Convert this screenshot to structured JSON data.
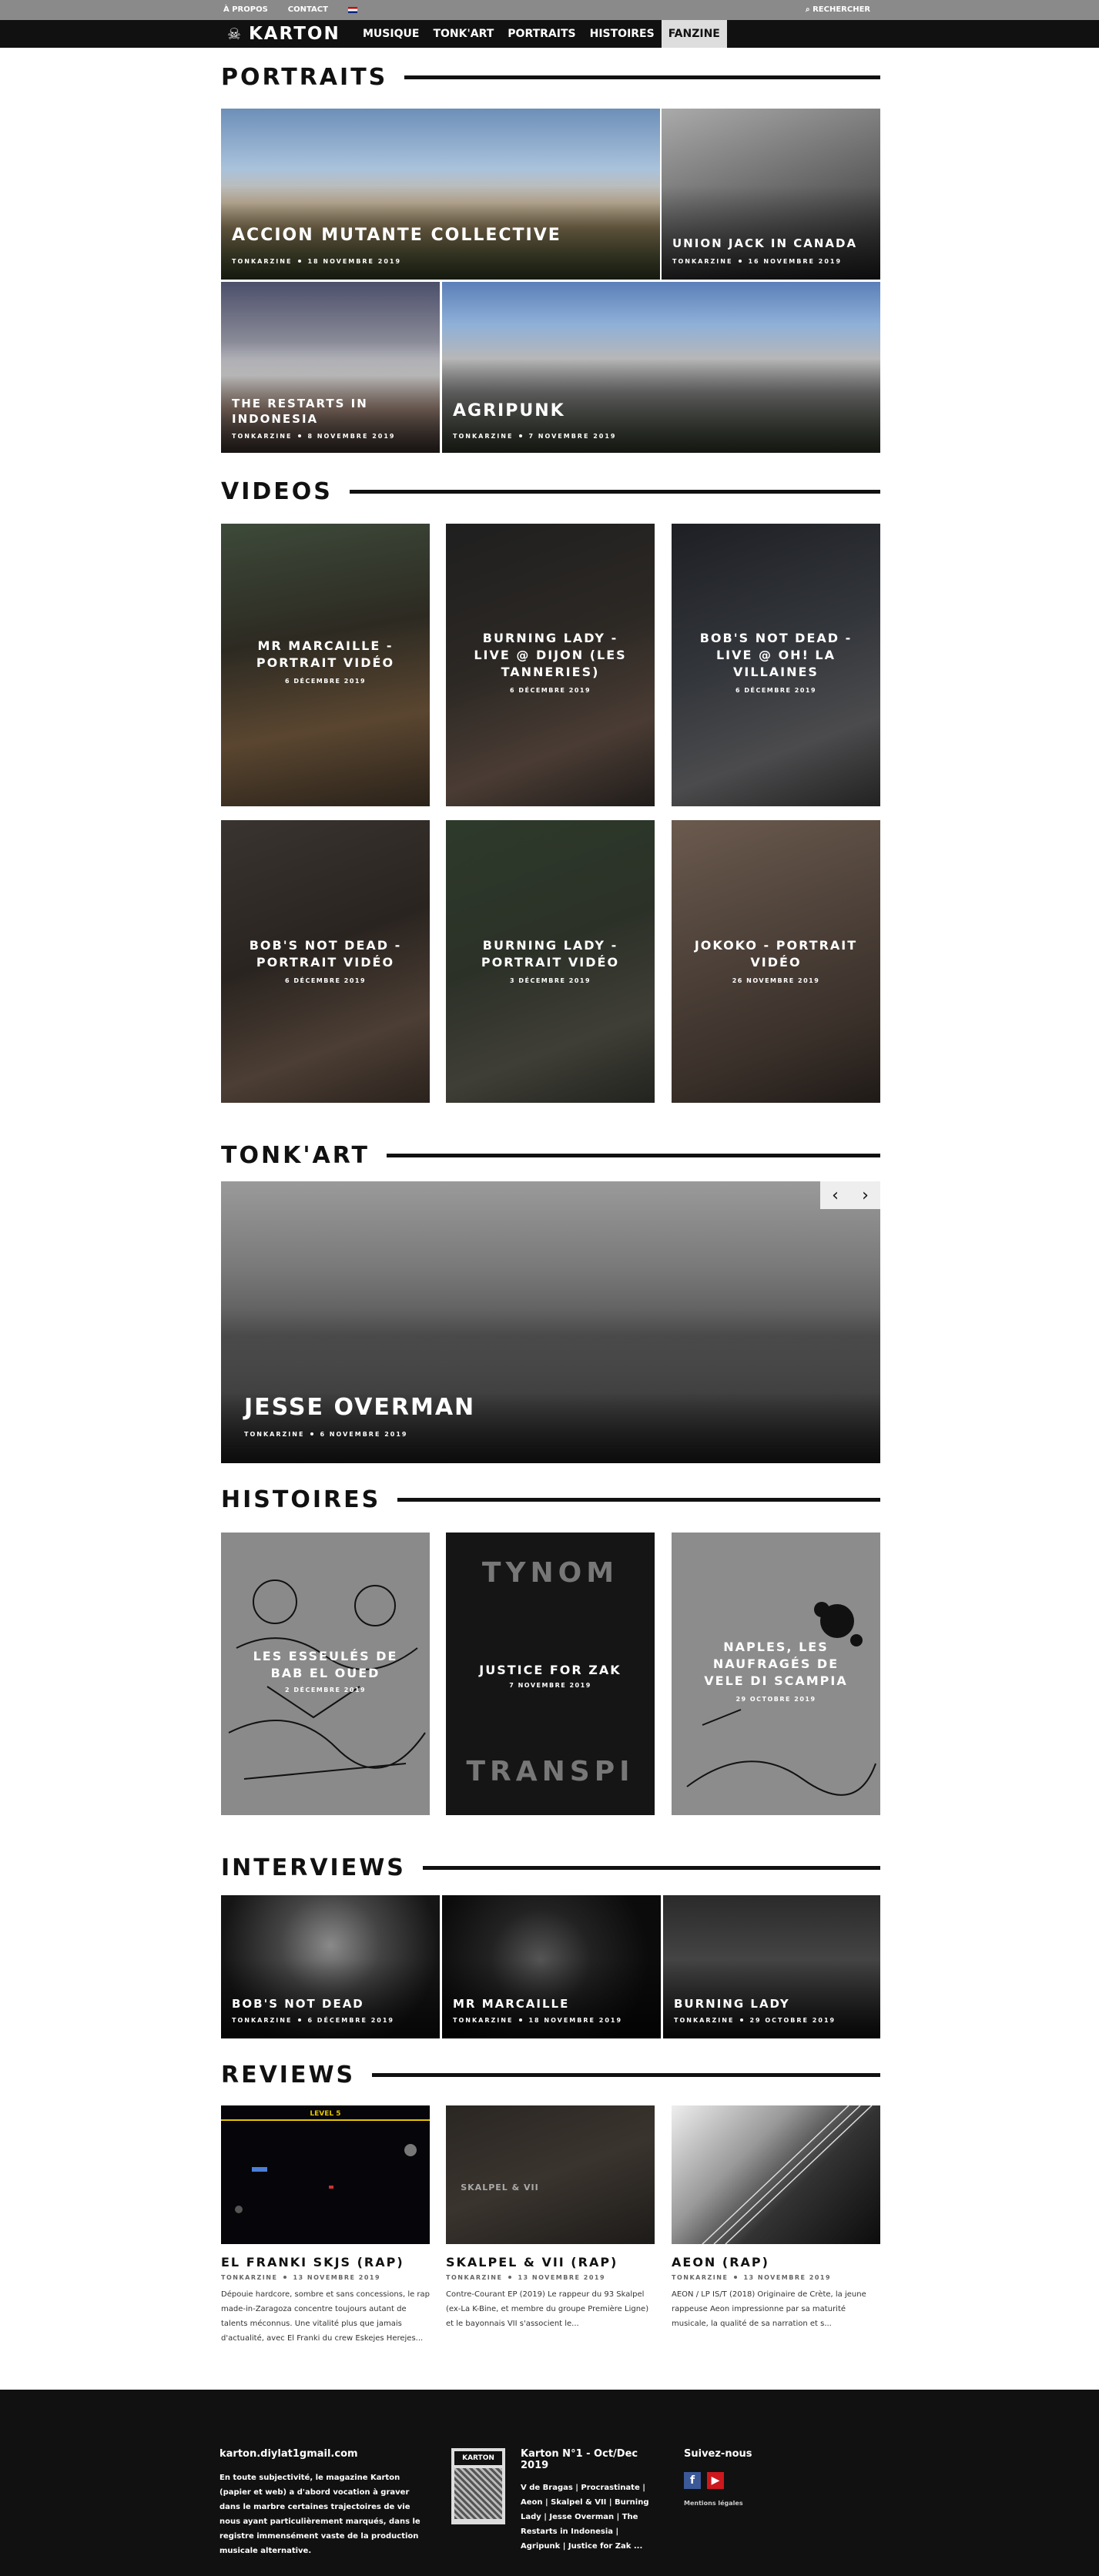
{
  "topbar": {
    "a_propos": "À PROPOS",
    "contact": "CONTACT",
    "search": "RECHERCHER"
  },
  "nav": {
    "logo": "KARTON",
    "items": [
      "MUSIQUE",
      "TONK'ART",
      "PORTRAITS",
      "HISTOIRES",
      "FANZINE"
    ],
    "active": "FANZINE"
  },
  "portraits": {
    "title": "PORTRAITS",
    "items": [
      {
        "title": "ACCION MUTANTE COLLECTIVE",
        "author": "TONKARZINE",
        "date": "18 NOVEMBRE 2019"
      },
      {
        "title": "UNION JACK IN CANADA",
        "author": "TONKARZINE",
        "date": "16 NOVEMBRE 2019"
      },
      {
        "title": "THE RESTARTS IN INDONESIA",
        "author": "TONKARZINE",
        "date": "8 NOVEMBRE 2019"
      },
      {
        "title": "AGRIPUNK",
        "author": "TONKARZINE",
        "date": "7 NOVEMBRE 2019"
      }
    ]
  },
  "videos": {
    "title": "VIDEOS",
    "items": [
      {
        "title": "MR MARCAILLE - PORTRAIT VIDÉO",
        "date": "6 DÉCEMBRE 2019"
      },
      {
        "title": "BURNING LADY - LIVE @ DIJON (LES TANNERIES)",
        "date": "6 DÉCEMBRE 2019"
      },
      {
        "title": "BOB'S NOT DEAD - LIVE @ OH! LA VILLAINES",
        "date": "6 DÉCEMBRE 2019"
      },
      {
        "title": "BOB'S NOT DEAD - PORTRAIT VIDÉO",
        "date": "6 DÉCEMBRE 2019"
      },
      {
        "title": "BURNING LADY - PORTRAIT VIDÉO",
        "date": "3 DÉCEMBRE 2019"
      },
      {
        "title": "JOKOKO - PORTRAIT VIDÉO",
        "date": "26 NOVEMBRE 2019"
      }
    ]
  },
  "tonkart": {
    "title": "TONK'ART",
    "feature": {
      "title": "JESSE OVERMAN",
      "author": "TONKARZINE",
      "date": "6 NOVEMBRE 2019"
    },
    "prev": "‹",
    "next": "›"
  },
  "histoires": {
    "title": "HISTOIRES",
    "items": [
      {
        "title": "LES ESSEULÉS DE BAB EL OUED",
        "date": "2 DÉCEMBRE 2019"
      },
      {
        "title": "JUSTICE FOR ZAK",
        "date": "7 NOVEMBRE 2019",
        "art_text_top": "TYNOM",
        "art_text_bottom": "TRANSPI"
      },
      {
        "title": "NAPLES, LES NAUFRAGÉS DE VELE DI SCAMPIA",
        "date": "29 OCTOBRE 2019"
      }
    ]
  },
  "interviews": {
    "title": "INTERVIEWS",
    "items": [
      {
        "title": "BOB'S NOT DEAD",
        "author": "TONKARZINE",
        "date": "6 DÉCEMBRE 2019"
      },
      {
        "title": "MR MARCAILLE",
        "author": "TONKARZINE",
        "date": "18 NOVEMBRE 2019"
      },
      {
        "title": "BURNING LADY",
        "author": "TONKARZINE",
        "date": "29 OCTOBRE 2019"
      }
    ]
  },
  "reviews": {
    "title": "REVIEWS",
    "items": [
      {
        "title": "EL FRANKI SKJS (RAP)",
        "author": "TONKARZINE",
        "date": "13 NOVEMBRE 2019",
        "excerpt": "Dépouie hardcore, sombre et sans concessions, le rap made-in-Zaragoza concentre toujours autant de talents méconnus. Une vitalité plus que jamais d'actualité, avec El Franki du crew Eskejes Herejes...",
        "art_text": "LEVEL 5"
      },
      {
        "title": "SKALPEL & VII (RAP)",
        "author": "TONKARZINE",
        "date": "13 NOVEMBRE 2019",
        "excerpt": "Contre-Courant EP (2019) Le rappeur du 93 Skalpel (ex-La K-Bine, et membre du groupe Première Ligne) et le bayonnais VII s'associent le...",
        "art_text": "SKALPEL & VII"
      },
      {
        "title": "AEON (RAP)",
        "author": "TONKARZINE",
        "date": "13 NOVEMBRE 2019",
        "excerpt": "AEON / LP IS/T (2018) Originaire de Crète, la jeune rappeuse Aeon impressionne par sa maturité musicale, la qualité de sa narration et s..."
      }
    ]
  },
  "footer": {
    "email": "karton.diylat1gmail.com",
    "about": "En toute subjectivité, le magazine Karton (papier et web) a d'abord vocation à graver dans le marbre certaines trajectoires de vie nous ayant particulièrement marqués, dans le registre immensément vaste de la production musicale alternative.",
    "issue_title": "Karton N°1 - Oct/Dec 2019",
    "issue_desc": "V de Bragas | Procrastinate | Aeon | Skalpel & VII | Burning Lady | Jesse Overman | The Restarts in Indonesia | Agripunk | Justice for Zak ...",
    "cover_label": "KARTON",
    "follow": "Suivez-nous",
    "legal": "Mentions légales",
    "colors": {
      "facebook": "#3b5998",
      "youtube": "#cc181e"
    }
  }
}
